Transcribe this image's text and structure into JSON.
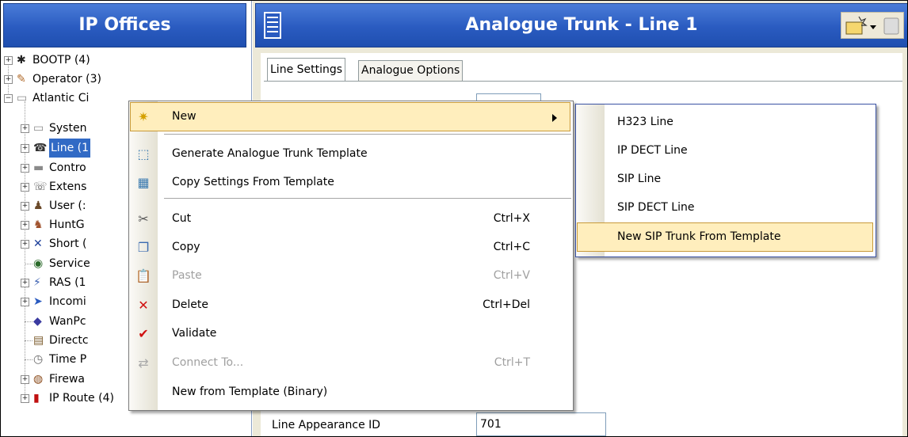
{
  "left_pane": {
    "title": "IP Offices"
  },
  "tree": [
    {
      "label": "BOOTP (4)",
      "icon": "bootp-icon"
    },
    {
      "label": "Operator (3)",
      "icon": "operator-icon"
    },
    {
      "label": "Atlantic Ci",
      "icon": "system-icon"
    },
    {
      "label": "Systen",
      "icon": "system-icon"
    },
    {
      "label": "Line (1",
      "icon": "line-icon",
      "selected": true
    },
    {
      "label": "Contro",
      "icon": "control-unit-icon"
    },
    {
      "label": "Extens",
      "icon": "extension-icon"
    },
    {
      "label": "User (:",
      "icon": "user-icon"
    },
    {
      "label": "HuntG",
      "icon": "hunt-group-icon"
    },
    {
      "label": "Short (",
      "icon": "short-code-icon"
    },
    {
      "label": "Service",
      "icon": "service-icon"
    },
    {
      "label": "RAS (1",
      "icon": "ras-icon"
    },
    {
      "label": "Incomi",
      "icon": "incoming-call-route-icon"
    },
    {
      "label": "WanPc",
      "icon": "wan-port-icon"
    },
    {
      "label": "Directc",
      "icon": "directory-icon"
    },
    {
      "label": "Time P",
      "icon": "time-profile-icon"
    },
    {
      "label": "Firewa",
      "icon": "firewall-icon"
    },
    {
      "label": "IP Route (4)",
      "icon": "ip-route-icon"
    }
  ],
  "right_pane": {
    "title": "Analogue Trunk - Line 1",
    "tabs": [
      "Line Settings",
      "Analogue Options"
    ],
    "fields": [
      {
        "label": "Line Appearance ID",
        "value": "701"
      }
    ]
  },
  "context_menu": {
    "items": [
      {
        "label": "New",
        "shortcut": "",
        "icon": "new-icon",
        "submenu": true,
        "highlighted": true
      },
      {
        "label": "Generate Analogue Trunk Template",
        "shortcut": "",
        "icon": "generate-template-icon"
      },
      {
        "label": "Copy Settings From Template",
        "shortcut": "",
        "icon": "copy-settings-icon"
      },
      {
        "label": "Cut",
        "shortcut": "Ctrl+X",
        "icon": "cut-icon"
      },
      {
        "label": "Copy",
        "shortcut": "Ctrl+C",
        "icon": "copy-icon"
      },
      {
        "label": "Paste",
        "shortcut": "Ctrl+V",
        "icon": "paste-icon",
        "disabled": true
      },
      {
        "label": "Delete",
        "shortcut": "Ctrl+Del",
        "icon": "delete-icon"
      },
      {
        "label": "Validate",
        "shortcut": "",
        "icon": "validate-icon"
      },
      {
        "label": "Connect To...",
        "shortcut": "Ctrl+T",
        "icon": "connect-icon",
        "disabled": true
      },
      {
        "label": "New from Template (Binary)",
        "shortcut": "",
        "icon": ""
      }
    ]
  },
  "submenu": {
    "items": [
      {
        "label": "H323 Line"
      },
      {
        "label": "IP DECT Line"
      },
      {
        "label": "SIP Line"
      },
      {
        "label": "SIP DECT Line"
      },
      {
        "label": "New SIP Trunk From Template",
        "highlighted": true
      }
    ]
  },
  "colors": {
    "header_blue": "#2a5bc0",
    "selection": "#316ac5",
    "menu_highlight": "#ffeebd"
  }
}
